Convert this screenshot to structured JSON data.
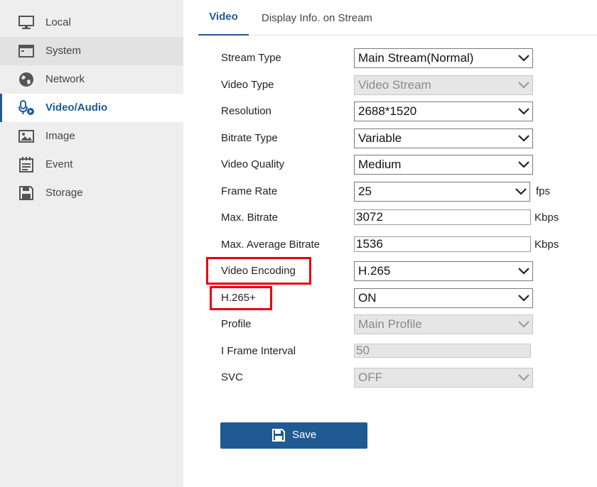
{
  "sidebar": {
    "items": [
      {
        "label": "Local",
        "icon": "monitor-icon"
      },
      {
        "label": "System",
        "icon": "system-window-icon"
      },
      {
        "label": "Network",
        "icon": "globe-icon"
      },
      {
        "label": "Video/Audio",
        "icon": "microphone-camera-icon"
      },
      {
        "label": "Image",
        "icon": "image-icon"
      },
      {
        "label": "Event",
        "icon": "calendar-list-icon"
      },
      {
        "label": "Storage",
        "icon": "floppy-disk-icon"
      }
    ],
    "active": "Video/Audio"
  },
  "tabs": [
    {
      "label": "Video"
    },
    {
      "label": "Display Info. on Stream"
    }
  ],
  "form": {
    "stream_type": {
      "label": "Stream Type",
      "value": "Main Stream(Normal)"
    },
    "video_type": {
      "label": "Video Type",
      "value": "Video Stream"
    },
    "resolution": {
      "label": "Resolution",
      "value": "2688*1520"
    },
    "bitrate_type": {
      "label": "Bitrate Type",
      "value": "Variable"
    },
    "video_quality": {
      "label": "Video Quality",
      "value": "Medium"
    },
    "frame_rate": {
      "label": "Frame Rate",
      "value": "25",
      "unit": "fps"
    },
    "max_bitrate": {
      "label": "Max. Bitrate",
      "value": "3072",
      "unit": "Kbps"
    },
    "max_avg_bitrate": {
      "label": "Max. Average Bitrate",
      "value": "1536",
      "unit": "Kbps"
    },
    "video_encoding": {
      "label": "Video Encoding",
      "value": "H.265"
    },
    "h265_plus": {
      "label": "H.265+",
      "value": "ON"
    },
    "profile": {
      "label": "Profile",
      "value": "Main Profile"
    },
    "i_frame_interval": {
      "label": "I Frame Interval",
      "value": "50"
    },
    "svc": {
      "label": "SVC",
      "value": "OFF"
    }
  },
  "save_label": "Save",
  "colors": {
    "accent": "#1f5a93",
    "highlight_box": "#e8000a",
    "sidebar_bg": "#eeeeee"
  }
}
